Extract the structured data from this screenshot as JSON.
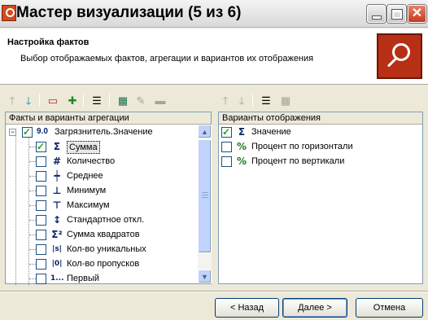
{
  "window": {
    "title": "Мастер визуализации (5 из 6)"
  },
  "header": {
    "title": "Настройка фактов",
    "subtitle": "Выбор отображаемых фактов, агрегации и вариантов их отображения",
    "logo_icon": "magnifier-icon"
  },
  "left_panel": {
    "heading": "Факты и варианты агрегации",
    "root": {
      "badge": "9.0",
      "label": "Загрязнитель.Значение",
      "checked": true,
      "expanded": true
    },
    "items": [
      {
        "icon": "Σ",
        "icon_name": "sum-icon",
        "label": "Сумма",
        "checked": true,
        "selected": true
      },
      {
        "icon": "#",
        "icon_name": "count-icon",
        "label": "Количество",
        "checked": false
      },
      {
        "icon": "┿",
        "icon_name": "average-icon",
        "label": "Среднее",
        "checked": false
      },
      {
        "icon": "⊥",
        "icon_name": "minimum-icon",
        "label": "Минимум",
        "checked": false
      },
      {
        "icon": "⊤",
        "icon_name": "maximum-icon",
        "label": "Максимум",
        "checked": false
      },
      {
        "icon": "↕",
        "icon_name": "std-dev-icon",
        "label": "Стандартное откл.",
        "checked": false
      },
      {
        "icon": "Σ²",
        "icon_name": "sum-squares-icon",
        "label": "Сумма квадратов",
        "checked": false
      },
      {
        "icon": "|s|",
        "icon_name": "unique-count-icon",
        "label": "Кол-во уникальных",
        "checked": false
      },
      {
        "icon": "|0|",
        "icon_name": "missing-count-icon",
        "label": "Кол-во пропусков",
        "checked": false
      },
      {
        "icon": "1...",
        "icon_name": "first-icon",
        "label": "Первый",
        "checked": false
      }
    ]
  },
  "right_panel": {
    "heading": "Варианты отображения",
    "items": [
      {
        "icon": "Σ",
        "icon_name": "sum-icon",
        "label": "Значение",
        "checked": true
      },
      {
        "icon": "%",
        "icon_name": "percent-horizontal-icon",
        "label": "Процент по горизонтали",
        "checked": false
      },
      {
        "icon": "%",
        "icon_name": "percent-vertical-icon",
        "label": "Процент по вертикали",
        "checked": false
      }
    ]
  },
  "buttons": {
    "back": "< Назад",
    "next": "Далее >",
    "cancel": "Отмена"
  }
}
